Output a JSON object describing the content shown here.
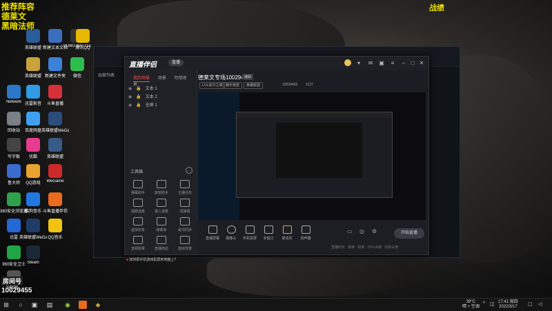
{
  "overlay": {
    "left_lines": [
      "推荐阵容",
      "德莱文",
      "黑暗法师"
    ],
    "right_text": "战绩",
    "room_label": "房间号",
    "room_number": "10029455"
  },
  "desktop_icons": [
    {
      "label": "英雄联盟",
      "color": "#2b5d9b"
    },
    {
      "label": "新建文本文档",
      "color": "#3b6dbf"
    },
    {
      "label": "PUBG BATTLEGR...",
      "color": "#333333"
    },
    {
      "label": "腾讯QQ",
      "color": "#e6b800"
    },
    {
      "label": "英雄联盟",
      "color": "#c8a23a"
    },
    {
      "label": "新建文件夹",
      "color": "#3b82d6"
    },
    {
      "label": "微信",
      "color": "#2dbd4e"
    },
    {
      "label": "Network",
      "color": "#2a77c9"
    },
    {
      "label": "迅雷影音",
      "color": "#2f9be5"
    },
    {
      "label": "斗鱼直播",
      "color": "#d6303a"
    },
    {
      "label": "回收站",
      "color": "#7a7f88"
    },
    {
      "label": "百度网盘",
      "color": "#3fa0f2"
    },
    {
      "label": "英雄联盟WeGame版",
      "color": "#2b4d7b"
    },
    {
      "label": "写字板",
      "color": "#444444"
    },
    {
      "label": "优酷",
      "color": "#e73b8f"
    },
    {
      "label": "英雄联盟",
      "color": "#375a86"
    },
    {
      "label": "鲁大师",
      "color": "#3a6ccf"
    },
    {
      "label": "QQ游戏",
      "color": "#e8a22e"
    },
    {
      "label": "WeGame",
      "color": "#cc2a2a"
    },
    {
      "label": "360安全浏览器",
      "color": "#2ea14a"
    },
    {
      "label": "酷狗音乐",
      "color": "#2277e0"
    },
    {
      "label": "斗鱼直播伴侣",
      "color": "#ea6b1e"
    },
    {
      "label": "迅雷",
      "color": "#2467d6"
    },
    {
      "label": "英雄联盟WeGame版",
      "color": "#1f3c66"
    },
    {
      "label": "QQ音乐",
      "color": "#f1c40f"
    },
    {
      "label": "360安全卫士",
      "color": "#21a347"
    },
    {
      "label": "Steam",
      "color": "#1b2838"
    },
    {
      "label": "S4696...",
      "color": "#555555"
    }
  ],
  "app": {
    "logo": "直播伴侣",
    "live_button": "直播",
    "left_tabs": [
      "我的场景",
      "场景",
      "可用场景"
    ],
    "sources": [
      {
        "name": "文本 1"
      },
      {
        "name": "文本 2"
      },
      {
        "name": "全屏 1"
      }
    ],
    "tools_title": "工具箱",
    "tools": [
      "弹幕助手",
      "房管助手",
      "主播任务",
      "视频连麦",
      "录入连麦",
      "调弹幕",
      "虚拟形象",
      "弹幕库",
      "歌词同步",
      "音频效果",
      "直播商店",
      "虚拟背景"
    ],
    "tip": "如何把手机游戏投屏到电脑上?",
    "room_title": "德莱文专场10029455",
    "room_badge": "编辑",
    "pills": [
      "LOL官方之旅",
      "娱乐竞技",
      "英雄联盟"
    ],
    "room_id": "10029455",
    "viewers": "1137",
    "bottom_buttons": [
      "直播屏幕",
      "摄像头",
      "手机投屏",
      "多窗口",
      "麦克风",
      "扬声器"
    ],
    "start_button": "开始直播"
  },
  "status_bar": [
    "直播时长",
    "帧率",
    "码率",
    "CPU占用",
    "内存占用"
  ],
  "taskbar": {
    "weather_temp": "39°C",
    "weather_desc": "晴 + 空调",
    "time": "17:41 周四",
    "date": "2022/3/17"
  }
}
